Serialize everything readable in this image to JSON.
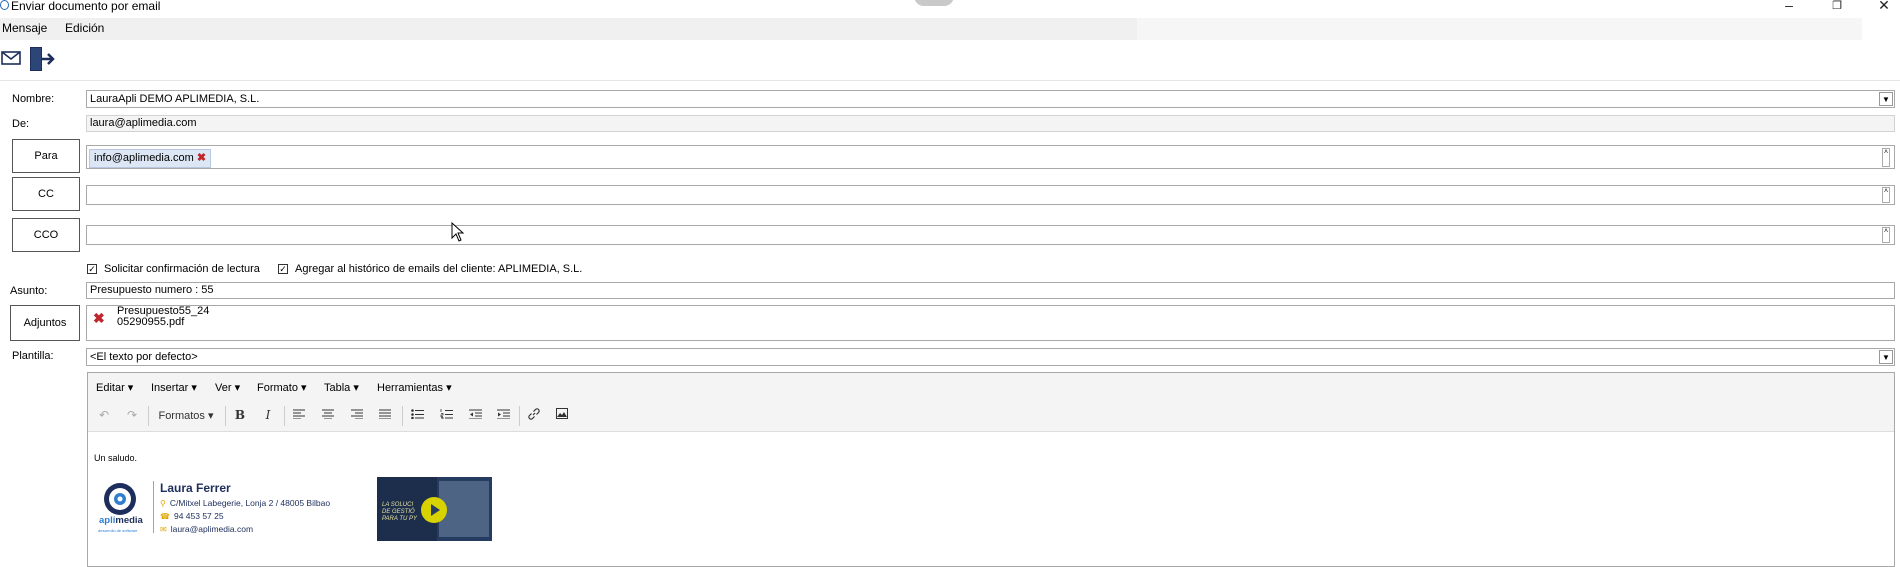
{
  "window": {
    "title": "Enviar documento por email",
    "controls": [
      "minimize",
      "restore",
      "close"
    ]
  },
  "menu": [
    "Mensaje",
    "Edición"
  ],
  "toolbar": {
    "icons": [
      "envelope-icon",
      "exit-icon"
    ]
  },
  "form": {
    "nombre_label": "Nombre:",
    "nombre_value": "LauraApli DEMO APLIMEDIA, S.L.",
    "de_label": "De:",
    "de_value": "laura@aplimedia.com",
    "para_label": "Para",
    "para_chip": "info@aplimedia.com",
    "cc_label": "CC",
    "cco_label": "CCO",
    "check_confirm": "Solicitar confirmación de lectura",
    "check_history": "Agregar al histórico de emails del cliente: APLIMEDIA, S.L.",
    "asunto_label": "Asunto:",
    "asunto_value": "Presupuesto numero : 55",
    "adjuntos_label": "Adjuntos",
    "attachment_line1": "Presupuesto55_24",
    "attachment_line2": "05290955.pdf",
    "plantilla_label": "Plantilla:",
    "plantilla_value": "<El texto por defecto>"
  },
  "editor": {
    "menu": [
      "Editar",
      "Insertar",
      "Ver",
      "Formato",
      "Tabla",
      "Herramientas"
    ],
    "formats_label": "Formatos",
    "body_text": "Un saludo.",
    "signature": {
      "name": "Laura Ferrer",
      "address": "C/Mitxel Labegerie, Lonja 2 / 48005 Bilbao",
      "phone": "94 453 57 25",
      "email": "laura@aplimedia.com",
      "logo_word_a": "apli",
      "logo_word_b": "media",
      "logo_tagline": "desarrollo de software"
    },
    "video_lines": [
      "LA SOLUCI",
      "DE GESTIÓ",
      "PARA TU PY"
    ]
  },
  "colors": {
    "chip_bg": "#dde6f4",
    "remove_red": "#c0262d",
    "sig_accent": "#e0a400",
    "sig_text": "#1d2e5c",
    "video_bg": "#253c60",
    "play_yellow": "#d8d200"
  }
}
